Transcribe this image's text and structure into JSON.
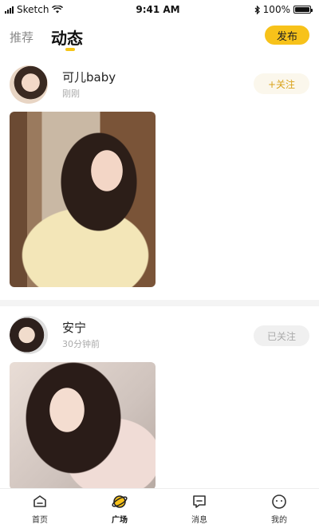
{
  "status_bar": {
    "carrier": "Sketch",
    "time": "9:41 AM",
    "battery": "100%",
    "battery_level": 1.0
  },
  "header": {
    "tabs": [
      {
        "label": "推荐"
      },
      {
        "label": "动态"
      }
    ],
    "publish_label": "发布",
    "accent_color": "#f7c21a"
  },
  "posts": [
    {
      "username": "可儿baby",
      "time": "刚刚",
      "follow_label": "+关注"
    },
    {
      "username": "安宁",
      "time": "30分钟前",
      "follow_label": "已关注"
    }
  ],
  "bottom_nav": {
    "items": [
      {
        "label": "首页",
        "icon": "home-icon"
      },
      {
        "label": "广场",
        "icon": "planet-icon"
      },
      {
        "label": "消息",
        "icon": "message-icon"
      },
      {
        "label": "我的",
        "icon": "profile-icon"
      }
    ]
  }
}
